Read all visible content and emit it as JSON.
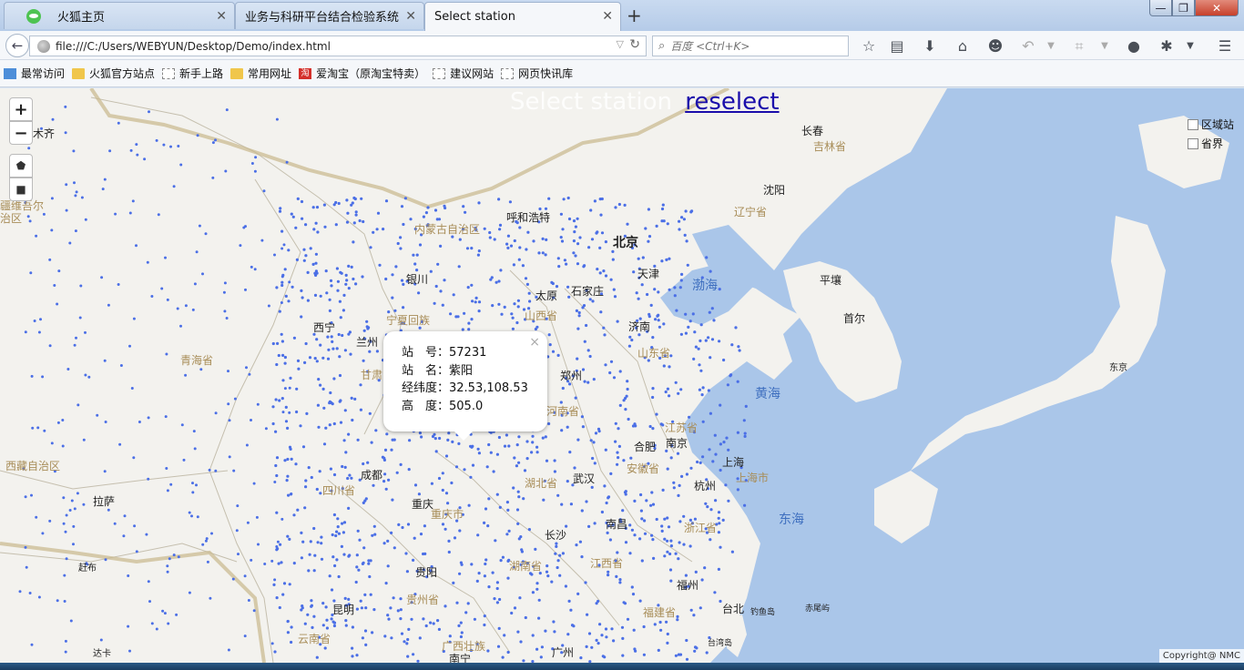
{
  "browser": {
    "tabs": [
      {
        "label": "火狐主页",
        "icon": "wechat-icon"
      },
      {
        "label": "业务与科研平台结合检验系统",
        "icon": "none"
      },
      {
        "label": "Select station",
        "icon": "none"
      }
    ],
    "new_tab_symbol": "+",
    "window": {
      "minimize": "—",
      "maximize": "❐",
      "close": "✕"
    },
    "url": "file:///C:/Users/WEBYUN/Desktop/Demo/index.html",
    "search_placeholder": "百度 <Ctrl+K>",
    "bookmarks": [
      {
        "label": "最常访问",
        "icon": "recent"
      },
      {
        "label": "火狐官方站点",
        "icon": "folder"
      },
      {
        "label": "新手上路",
        "icon": "dashed"
      },
      {
        "label": "常用网址",
        "icon": "folder"
      },
      {
        "label": "爱淘宝（原淘宝特卖）",
        "icon": "taobao"
      },
      {
        "label": "建议网站",
        "icon": "dashed"
      },
      {
        "label": "网页快讯库",
        "icon": "dashed"
      }
    ]
  },
  "map": {
    "title": "Select station",
    "reselect": "reselect",
    "zoom_in": "+",
    "zoom_out": "−",
    "layers": [
      {
        "label": "区域站",
        "checked": false
      },
      {
        "label": "省界",
        "checked": false
      }
    ],
    "popup": {
      "close": "×",
      "station_no": "站　号：57231",
      "station_name": "站　名：紫阳",
      "latlon": "经纬度：32.53,108.53",
      "altitude": "高　度：505.0"
    },
    "copyright": "Copyright@ NMC",
    "colors": {
      "land": "#f3f2ee",
      "sea": "#aac6e9",
      "station_dot": "#4b6fe6",
      "province_label": "#a88d58"
    },
    "cities": [
      {
        "name": "长春"
      },
      {
        "name": "沈阳"
      },
      {
        "name": "呼和浩特"
      },
      {
        "name": "北京"
      },
      {
        "name": "天津"
      },
      {
        "name": "平壤"
      },
      {
        "name": "首尔"
      },
      {
        "name": "银川"
      },
      {
        "name": "太原"
      },
      {
        "name": "石家庄"
      },
      {
        "name": "西宁"
      },
      {
        "name": "兰州"
      },
      {
        "name": "济南"
      },
      {
        "name": "东京"
      },
      {
        "name": "郑州"
      },
      {
        "name": "合肥"
      },
      {
        "name": "南京"
      },
      {
        "name": "上海"
      },
      {
        "name": "成都"
      },
      {
        "name": "武汉"
      },
      {
        "name": "杭州"
      },
      {
        "name": "重庆"
      },
      {
        "name": "拉萨"
      },
      {
        "name": "长沙"
      },
      {
        "name": "南昌"
      },
      {
        "name": "贵阳"
      },
      {
        "name": "福州"
      },
      {
        "name": "台北"
      },
      {
        "name": "昆明"
      },
      {
        "name": "南宁"
      },
      {
        "name": "广州"
      },
      {
        "name": "木齐"
      },
      {
        "name": "赶布"
      },
      {
        "name": "达卡"
      },
      {
        "name": "钓鱼岛"
      },
      {
        "name": "赤尾屿"
      },
      {
        "name": "台湾岛"
      }
    ],
    "provinces": [
      {
        "name": "内蒙古自治区"
      },
      {
        "name": "山西省"
      },
      {
        "name": "青海省"
      },
      {
        "name": "西藏自治区"
      },
      {
        "name": "四川省"
      },
      {
        "name": "重庆市"
      },
      {
        "name": "湖北省"
      },
      {
        "name": "安徽省"
      },
      {
        "name": "湖南省"
      },
      {
        "name": "江西省"
      },
      {
        "name": "贵州省"
      },
      {
        "name": "云南省"
      },
      {
        "name": "浙江省"
      },
      {
        "name": "福建省"
      },
      {
        "name": "辽宁省"
      },
      {
        "name": "吉林省"
      },
      {
        "name": "山东省"
      },
      {
        "name": "江苏省"
      },
      {
        "name": "河南省"
      },
      {
        "name": "甘肃"
      },
      {
        "name": "宁夏回族"
      },
      {
        "name": "上海市"
      },
      {
        "name": "广西壮族"
      },
      {
        "name": "疆维吾尔"
      },
      {
        "name": "治区"
      }
    ],
    "seas": [
      {
        "name": "渤海"
      },
      {
        "name": "黄海"
      },
      {
        "name": "东海"
      }
    ]
  }
}
